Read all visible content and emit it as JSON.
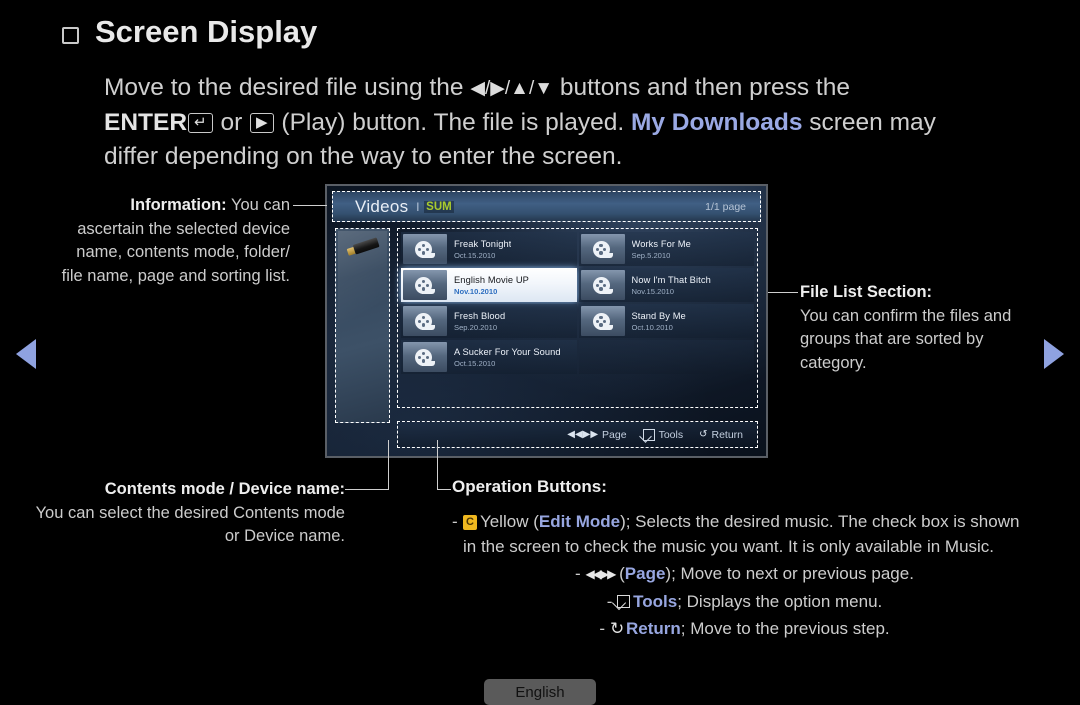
{
  "page": {
    "title": "Screen Display",
    "intro": {
      "line1_a": "Move to the desired file using the ",
      "arrows": "◀/▶/▲/▼",
      "line1_b": " buttons and then press the",
      "enter_label": "ENTER",
      "enter_glyph": "↵",
      "or_label": "or",
      "play_glyph": "▶",
      "line2_b": "(Play) button. The file is played. ",
      "highlight": "My Downloads",
      "line2_c": " screen may",
      "line3": "differ depending on the way to enter the screen."
    },
    "language_button": "English"
  },
  "nav": {
    "prev_icon": "left-triangle",
    "next_icon": "right-triangle",
    "color": "#8fa2e0"
  },
  "tv": {
    "header": {
      "title": "Videos",
      "separator": "l",
      "badge": "SUM",
      "badge_color": "#a9cc2e",
      "page": "1/1 page"
    },
    "device": {
      "icon": "usb-drive-icon"
    },
    "file_list": {
      "left_column": [
        {
          "name": "Freak Tonight",
          "date": "Oct.15.2010",
          "selected": false
        },
        {
          "name": "English Movie UP",
          "date": "Nov.10.2010",
          "selected": true
        },
        {
          "name": "Fresh Blood",
          "date": "Sep.20.2010",
          "selected": false
        },
        {
          "name": "A Sucker For Your Sound",
          "date": "Oct.15.2010",
          "selected": false
        }
      ],
      "right_column": [
        {
          "name": "Works For Me",
          "date": "Sep.5.2010",
          "selected": false
        },
        {
          "name": "Now I'm That Bitch",
          "date": "Nov.15.2010",
          "selected": false
        },
        {
          "name": "Stand By Me",
          "date": "Oct.10.2010",
          "selected": false
        }
      ]
    },
    "operation_bar": [
      {
        "icon": "page-prev-next-icon",
        "glyph": "◀◀▶▶",
        "label": "Page"
      },
      {
        "icon": "tools-icon",
        "glyph": "",
        "label": "Tools"
      },
      {
        "icon": "return-icon",
        "glyph": "↺",
        "label": "Return"
      }
    ]
  },
  "annotations": {
    "information": {
      "heading": "Information:",
      "body": "You can ascertain the selected device name, contents mode, folder/ file name, page and sorting list."
    },
    "file_list_section": {
      "heading": "File List Section:",
      "body": "You can confirm the files and groups that are sorted by category."
    },
    "contents_mode": {
      "heading": "Contents mode / Device name:",
      "body": "You can select the desired Contents mode or Device name."
    }
  },
  "operation_buttons": {
    "title": "Operation Buttons:",
    "items": [
      {
        "dash": "-",
        "key_badge": "C",
        "key_name": "Yellow (",
        "key_accent": "Edit Mode",
        "desc": "); Selects the desired music. The check box is shown in the screen to check the music you want. It is only available in Music."
      },
      {
        "dash": "-",
        "icon": "page-prev-next-icon",
        "glyph": "◀◀▶▶",
        "key_name": "(",
        "key_accent": "Page",
        "desc": "); Move to next or previous page."
      },
      {
        "dash": "-",
        "icon": "tools-icon",
        "key_accent": "Tools",
        "desc": "; Displays the option menu."
      },
      {
        "dash": "-",
        "icon": "return-icon",
        "glyph": "↺",
        "key_accent": "Return",
        "desc": "; Move to the previous step."
      }
    ]
  }
}
